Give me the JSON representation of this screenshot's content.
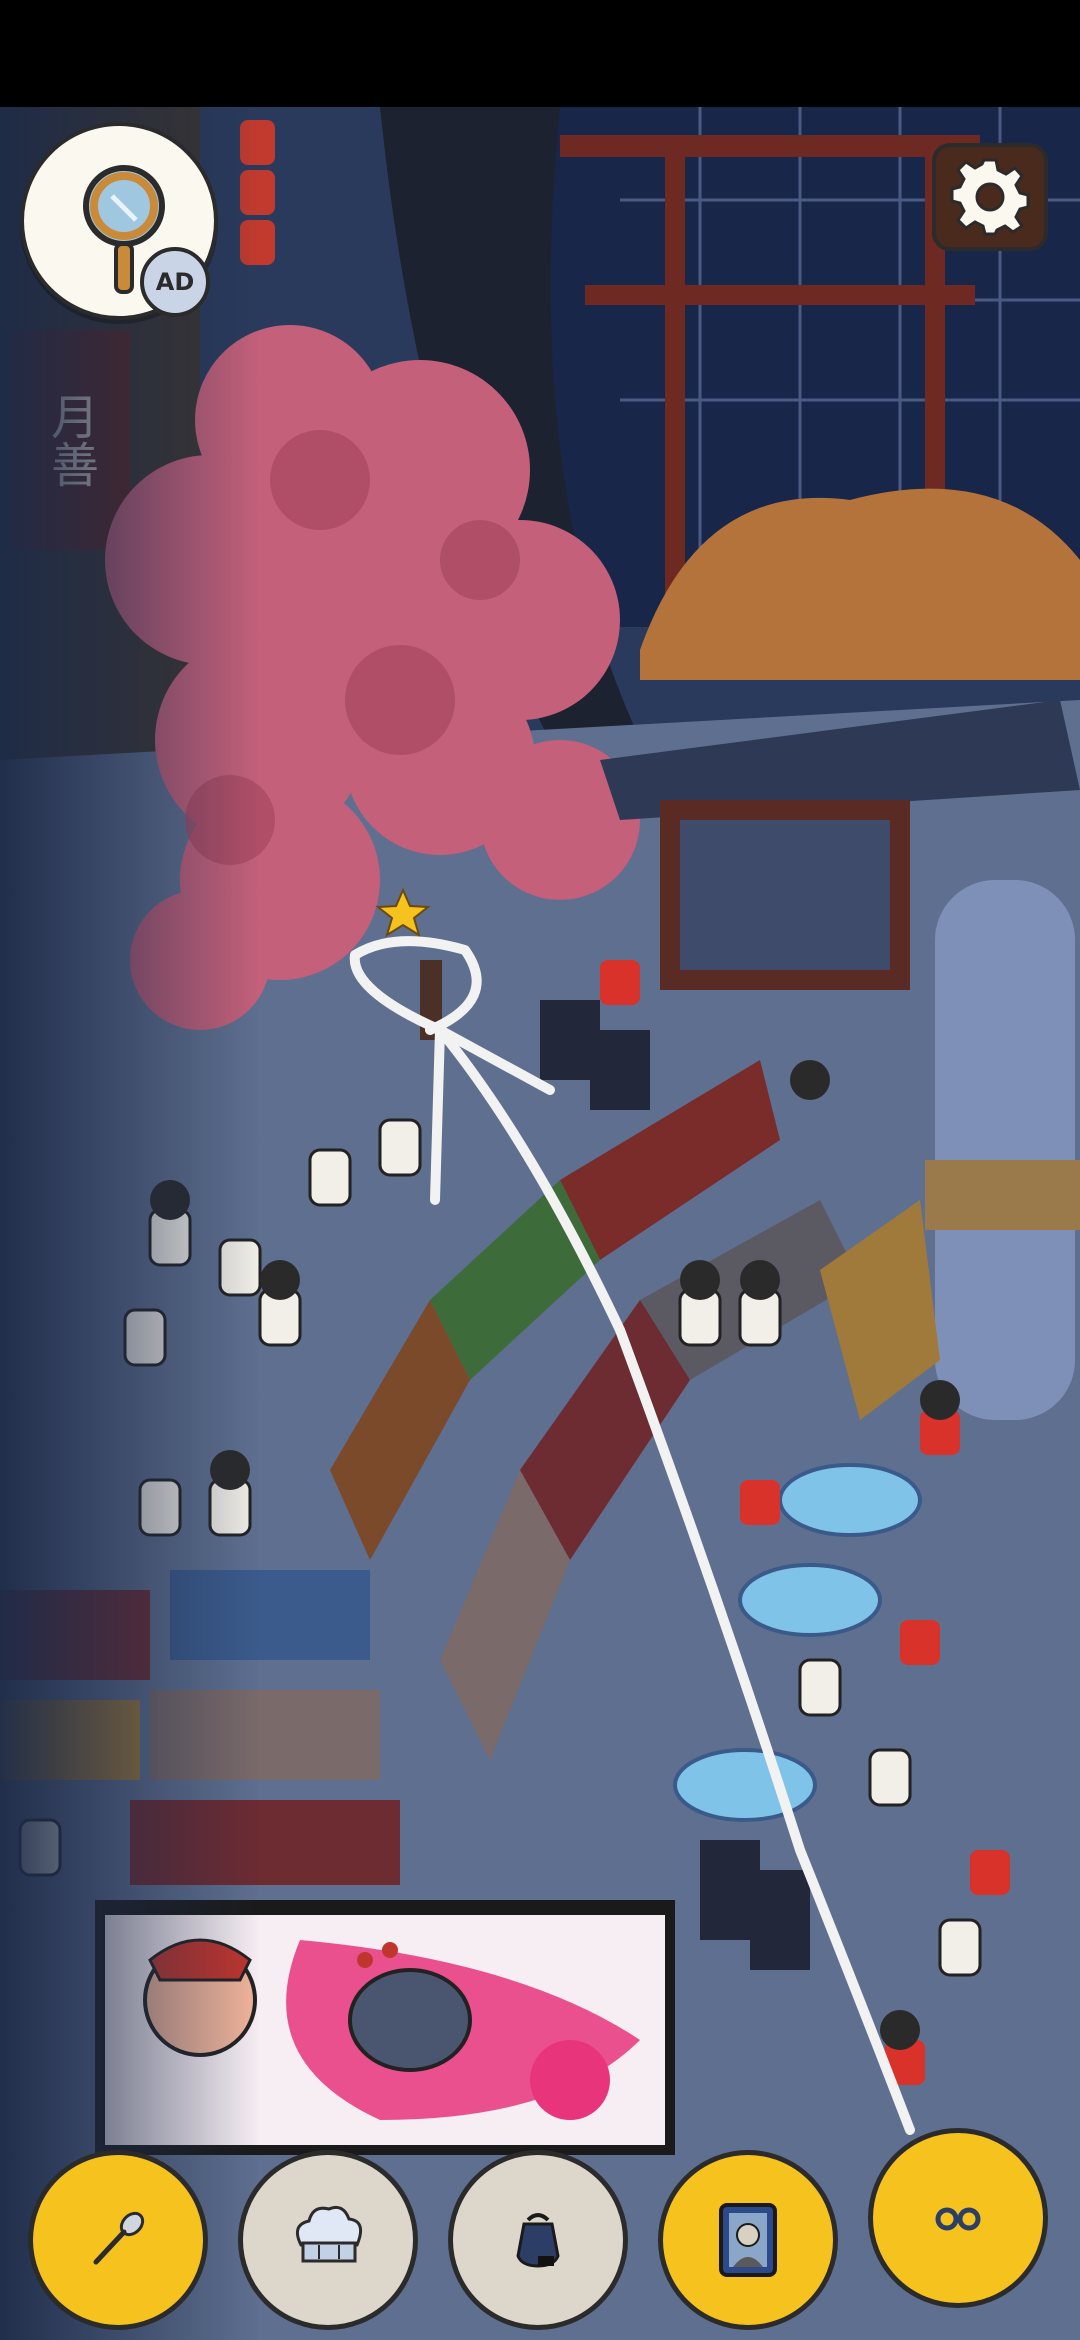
{
  "hint_button": {
    "badge": "AD",
    "icon": "magnifier-icon"
  },
  "settings_button": {
    "icon": "gear-icon"
  },
  "scene": {
    "sign_text": "月善",
    "colors": {
      "sky": "#1b2a46",
      "blossom": "#c4607a",
      "pavement": "#5f6f8f",
      "market_stall": "#7a2c2b",
      "billboard_bg": "#f7eef3"
    }
  },
  "toolbar": {
    "items": [
      {
        "name": "spoon-item",
        "icon": "spoon-icon",
        "color": "#f6c21e"
      },
      {
        "name": "chef-hat-item",
        "icon": "chef-hat-icon",
        "color": "#ddd6cb"
      },
      {
        "name": "pot-item",
        "icon": "pot-icon",
        "color": "#ddd6cb"
      },
      {
        "name": "portrait-item",
        "icon": "portrait-frame-icon",
        "color": "#f6c21e"
      },
      {
        "name": "glasses-item",
        "icon": "glasses-icon",
        "color": "#f6c21e"
      }
    ]
  }
}
